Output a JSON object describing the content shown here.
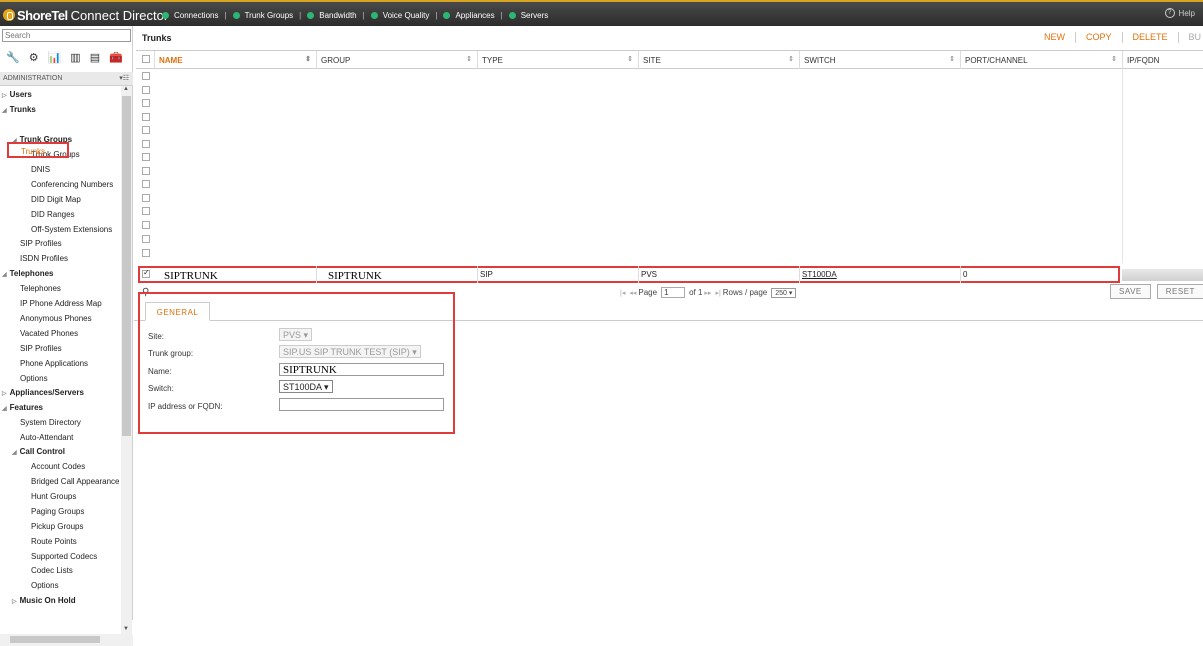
{
  "app": {
    "brand": "ShoreTel",
    "product": "Connect Director"
  },
  "topnav": [
    {
      "label": "Connections",
      "color": "#2bb673"
    },
    {
      "label": "Trunk Groups",
      "color": "#2bb673"
    },
    {
      "label": "Bandwidth",
      "color": "#2bb673"
    },
    {
      "label": "Voice Quality",
      "color": "#2bb673"
    },
    {
      "label": "Appliances",
      "color": "#2bb673"
    },
    {
      "label": "Servers",
      "color": "#2bb673"
    }
  ],
  "help": {
    "label": "Help"
  },
  "sidebar": {
    "search_placeholder": "Search",
    "section": "ADMINISTRATION",
    "tree": [
      {
        "label": "Users"
      },
      {
        "label": "Trunks"
      },
      {
        "label": "Trunks",
        "selected": true
      },
      {
        "label": "Trunk Groups"
      },
      {
        "label": "Trunk Groups"
      },
      {
        "label": "DNIS"
      },
      {
        "label": "Conferencing Numbers"
      },
      {
        "label": "DID Digit Map"
      },
      {
        "label": "DID Ranges"
      },
      {
        "label": "Off-System Extensions"
      },
      {
        "label": "SIP Profiles"
      },
      {
        "label": "ISDN Profiles"
      },
      {
        "label": "Telephones"
      },
      {
        "label": "Telephones"
      },
      {
        "label": "IP Phone Address Map"
      },
      {
        "label": "Anonymous Phones"
      },
      {
        "label": "Vacated Phones"
      },
      {
        "label": "SIP Profiles"
      },
      {
        "label": "Phone Applications"
      },
      {
        "label": "Options"
      },
      {
        "label": "Appliances/Servers"
      },
      {
        "label": "Features"
      },
      {
        "label": "System Directory"
      },
      {
        "label": "Auto-Attendant"
      },
      {
        "label": "Call Control"
      },
      {
        "label": "Account Codes"
      },
      {
        "label": "Bridged Call Appearance"
      },
      {
        "label": "Hunt Groups"
      },
      {
        "label": "Paging Groups"
      },
      {
        "label": "Pickup Groups"
      },
      {
        "label": "Route Points"
      },
      {
        "label": "Supported Codecs"
      },
      {
        "label": "Codec Lists"
      },
      {
        "label": "Options"
      },
      {
        "label": "Music On Hold"
      }
    ]
  },
  "main": {
    "title": "Trunks",
    "actions": [
      "NEW",
      "COPY",
      "DELETE",
      "BU"
    ],
    "columns": [
      "NAME",
      "GROUP",
      "TYPE",
      "SITE",
      "SWITCH",
      "PORT/CHANNEL",
      "IP/FQDN"
    ],
    "row": {
      "name": "SIPTRUNK",
      "group": "SIPTRUNK",
      "type": "SIP",
      "site": "PVS",
      "switch": "ST100DA",
      "port": "0"
    },
    "pager": {
      "page_label": "Page",
      "page": "1",
      "of": "of 1",
      "rows_label": "Rows / page",
      "rows": "250 ▾"
    },
    "buttons": {
      "save": "SAVE",
      "reset": "RESET"
    },
    "tab": "GENERAL",
    "form": {
      "site_label": "Site:",
      "site_value": "PVS ▾",
      "group_label": "Trunk group:",
      "group_value": "SIP.US SIP TRUNK TEST (SIP) ▾",
      "name_label": "Name:",
      "name_value": "SIPTRUNK",
      "switch_label": "Switch:",
      "switch_value": "ST100DA ▾",
      "ip_label": "IP address or FQDN:",
      "ip_value": ""
    }
  }
}
